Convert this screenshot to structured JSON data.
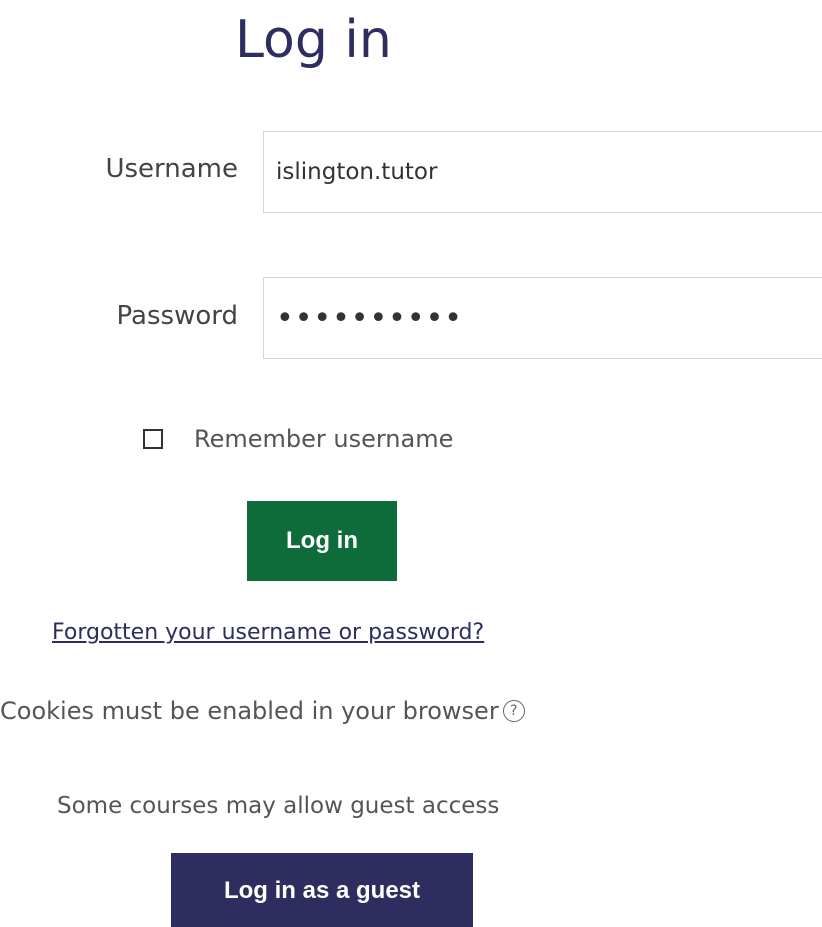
{
  "page_title": "Log in",
  "form": {
    "username_label": "Username",
    "username_value": "islington.tutor",
    "password_label": "Password",
    "password_value": "••••••••••",
    "remember_label": "Remember username",
    "remember_checked": false,
    "login_button_label": "Log in"
  },
  "links": {
    "forgot": "Forgotten your username or password?"
  },
  "cookies": {
    "text": "Cookies must be enabled in your browser",
    "help_icon": "question-circle-icon",
    "help_glyph": "?"
  },
  "guest": {
    "text": "Some courses may allow guest access",
    "button_label": "Log in as a guest"
  },
  "colors": {
    "primary_green": "#0e6b3a",
    "brand_navy": "#2e2d5f"
  }
}
